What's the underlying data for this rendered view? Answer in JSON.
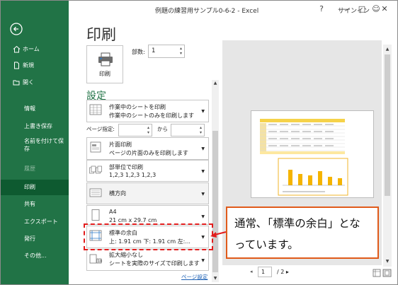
{
  "window": {
    "title": "例題の練習用サンプル0-6-2 - Excel",
    "signin": "サインイン",
    "buttons": {
      "feedback": "☺",
      "help": "?",
      "minimize": "—",
      "maximize": "□",
      "close": "✕"
    }
  },
  "nav": {
    "items": [
      {
        "label": "ホーム"
      },
      {
        "label": "新規"
      },
      {
        "label": "開く"
      },
      {
        "label": "情報"
      },
      {
        "label": "上書き保存"
      },
      {
        "label": "名前を付けて保存"
      },
      {
        "label": "履歴"
      },
      {
        "label": "印刷"
      },
      {
        "label": "共有"
      },
      {
        "label": "エクスポート"
      },
      {
        "label": "発行"
      },
      {
        "label": "その他..."
      }
    ]
  },
  "main": {
    "title": "印刷",
    "print_button": "印刷",
    "copies_label": "部数:",
    "copies_value": "1",
    "settings_title": "設定",
    "page_range_label": "ページ指定:",
    "page_range_to": "から",
    "page_setup_link": "ページ設定"
  },
  "settings": [
    {
      "l1": "作業中のシートを印刷",
      "l2": "作業中のシートのみを印刷します"
    },
    {
      "l1": "片面印刷",
      "l2": "ページの片面のみを印刷します"
    },
    {
      "l1": "部単位で印刷",
      "l2": "1,2,3    1,2,3    1,2,3"
    },
    {
      "l1": "横方向",
      "l2": ""
    },
    {
      "l1": "A4",
      "l2": "21 cm x 29.7 cm"
    },
    {
      "l1": "標準の余白",
      "l2": "上: 1.91 cm 下: 1.91 cm 左:..."
    },
    {
      "l1": "拡大縮小なし",
      "l2": "シートを実際のサイズで印刷します"
    }
  ],
  "pager": {
    "current": "1",
    "total": "/ 2 ▸"
  },
  "callout": {
    "text": "通常､「標準の余白」とな っています。"
  },
  "colors": {
    "nav_green": "#217346",
    "accent_green": "#217346",
    "highlight_red": "#e21c1c",
    "callout_border": "#e05a1a"
  }
}
